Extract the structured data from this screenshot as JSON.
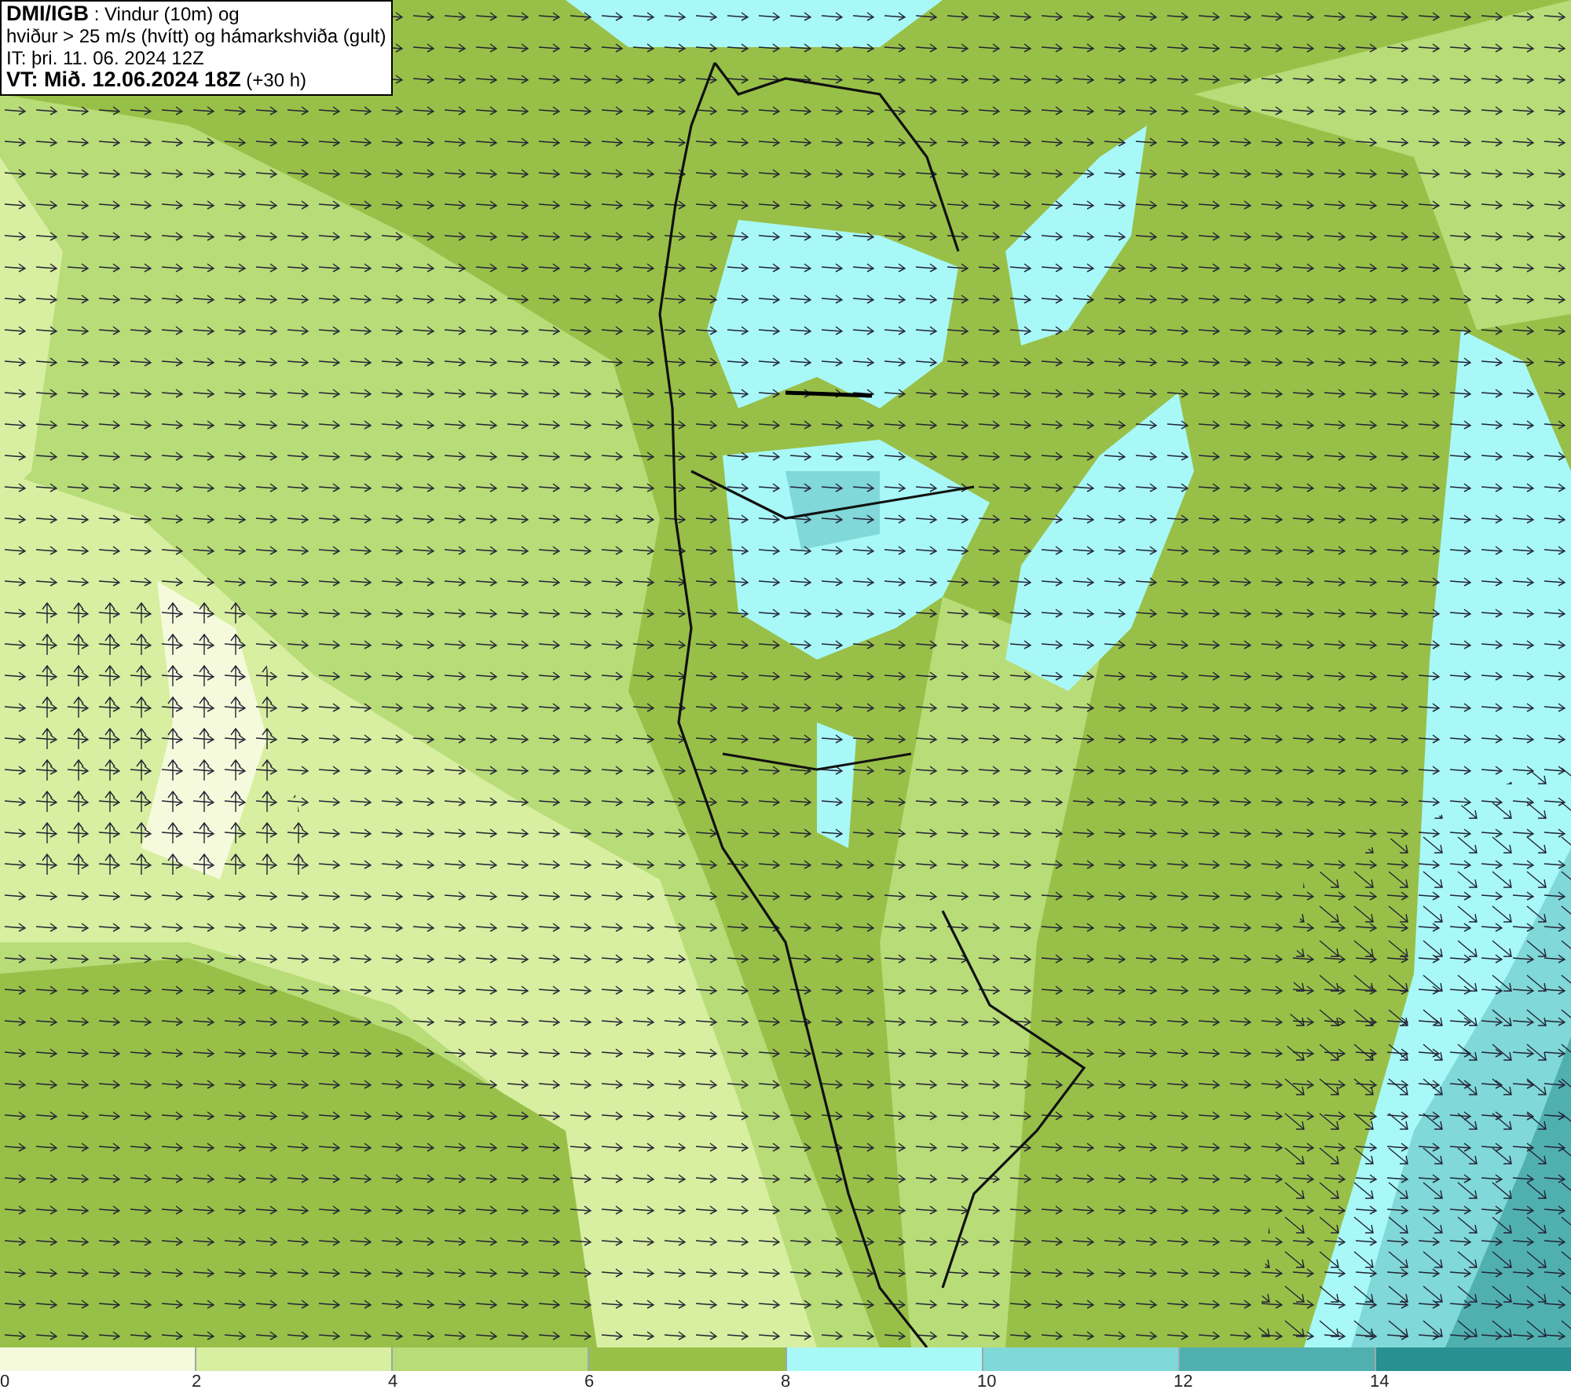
{
  "title_box": {
    "lines": [
      "**DMI/IGB** : Vindur (10m) og",
      "hviður > 25 m/s (hvítt) og hámarkshviða (gult)",
      "IT: þri. 11. 06. 2024 12Z",
      "**VT: Mið. 12.06.2024 18Z** (+30 h)"
    ]
  },
  "map": {
    "kind": "map"
  },
  "legend": {
    "segments": [
      {
        "label": "0",
        "color": "#f5fadc"
      },
      {
        "label": "2",
        "color": "#d8eea0"
      },
      {
        "label": "4",
        "color": "#b8dc78"
      },
      {
        "label": "6",
        "color": "#98c048"
      },
      {
        "label": "8",
        "color": "#a8f8f8"
      },
      {
        "label": "10",
        "color": "#80d8d8"
      },
      {
        "label": "12",
        "color": "#50b0b0"
      },
      {
        "label": "14",
        "color": "#289090"
      }
    ]
  }
}
